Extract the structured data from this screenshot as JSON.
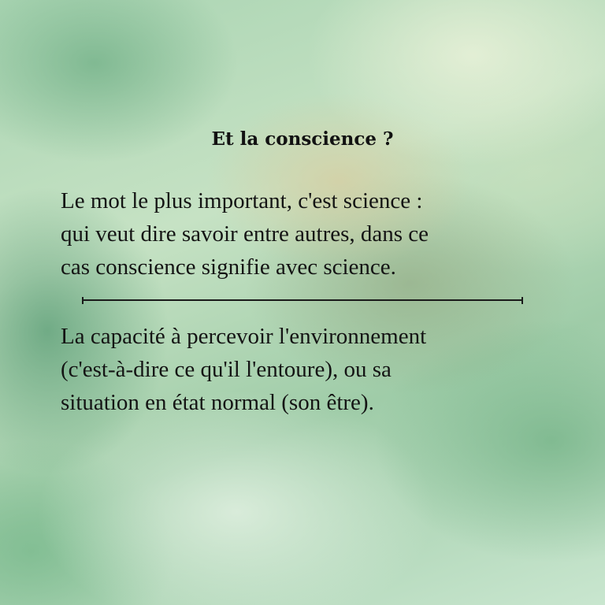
{
  "slide": {
    "title": "Et la conscience ?",
    "paragraph_1": {
      "lines": [
        "Le mot le plus important, c'est science :",
        "qui veut dire savoir entre autres, dans ce",
        "cas conscience signifie avec science."
      ]
    },
    "paragraph_2": {
      "lines": [
        "La capacité à percevoir l'environnement",
        "(c'est-à-dire ce qu'il l'entoure), ou sa",
        "situation en état normal (son être)."
      ]
    }
  },
  "colors": {
    "background": "#b9dcc0",
    "text": "#141414",
    "divider": "#1a1a1a"
  }
}
